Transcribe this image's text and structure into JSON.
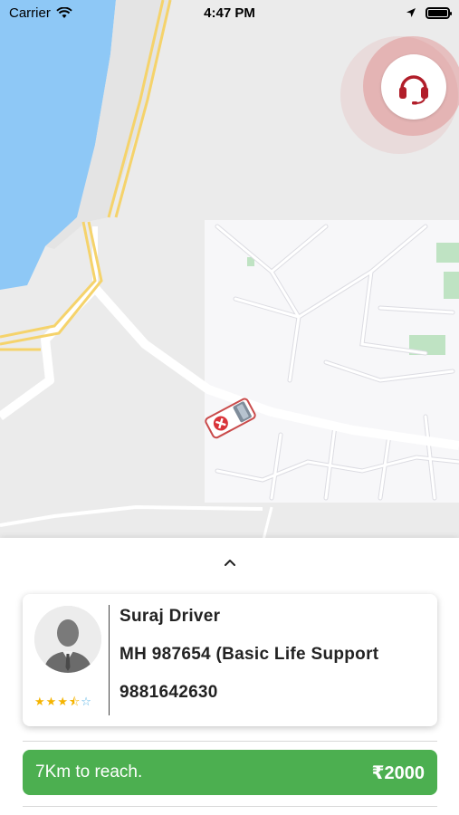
{
  "status_bar": {
    "carrier": "Carrier",
    "time": "4:47 PM"
  },
  "map": {
    "water_color": "#8ec8f6",
    "road_color_major": "#f5d36b",
    "road_color_minor": "#ffffff"
  },
  "support": {
    "icon": "headset-icon",
    "color": "#b11e2a"
  },
  "vehicle_marker": {
    "icon": "ambulance-icon"
  },
  "sheet": {
    "expand_icon": "chevron-up-icon"
  },
  "driver_card": {
    "name": "Suraj Driver",
    "vehicle": "MH 987654 (Basic Life Support",
    "phone": "9881642630",
    "rating": 3.5,
    "rating_max": 5
  },
  "eta": {
    "distance_text": "7Km to reach.",
    "price": "₹2000",
    "color": "#4caf50"
  }
}
